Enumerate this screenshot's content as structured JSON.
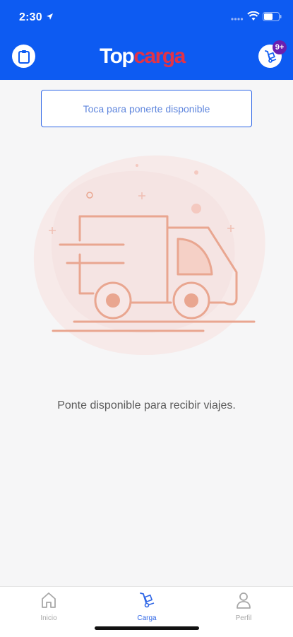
{
  "status_bar": {
    "time": "2:30"
  },
  "header": {
    "logo_part1": "Top",
    "logo_part2": "carga",
    "notification_count": "9+"
  },
  "main": {
    "availability_button": "Toca para ponerte disponible",
    "empty_message": "Ponte disponible para recibir viajes."
  },
  "tabbar": {
    "items": [
      {
        "label": "Inicio",
        "icon": "home-icon"
      },
      {
        "label": "Carga",
        "icon": "cargo-dolly-icon"
      },
      {
        "label": "Perfil",
        "icon": "user-icon"
      }
    ],
    "active": "Carga"
  },
  "colors": {
    "header_bg": "#0d5bf2",
    "accent": "#2f66e6",
    "logo_red": "#e23347",
    "badge": "#6a1fb0",
    "illustration": "#e9a690"
  }
}
